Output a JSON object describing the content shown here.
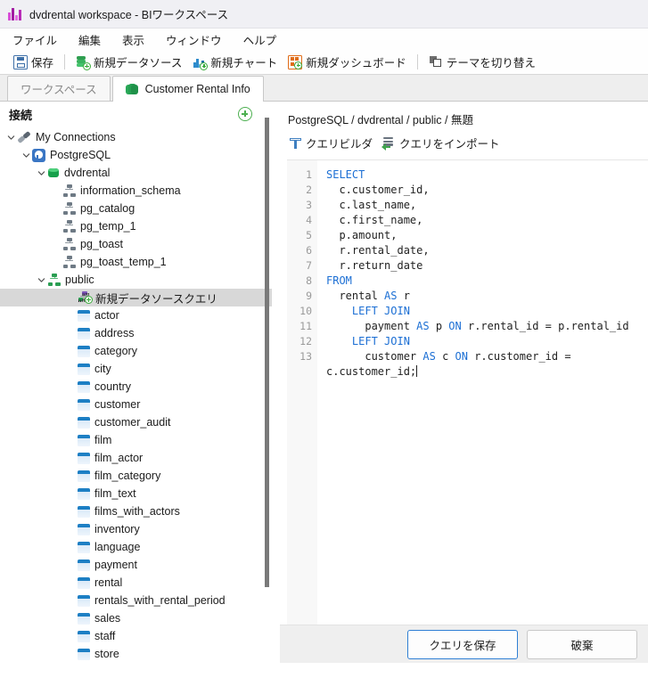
{
  "window": {
    "title": "dvdrental workspace - BIワークスペース",
    "app_icon": "bar-chart-icon"
  },
  "menubar": {
    "items": [
      "ファイル",
      "編集",
      "表示",
      "ウィンドウ",
      "ヘルプ"
    ]
  },
  "toolbar": {
    "save_label": "保存",
    "new_datasource_label": "新規データソース",
    "new_chart_label": "新規チャート",
    "new_dashboard_label": "新規ダッシュボード",
    "switch_theme_label": "テーマを切り替え"
  },
  "tabs": [
    {
      "label": "ワークスペース",
      "active": false,
      "icon": ""
    },
    {
      "label": "Customer Rental Info",
      "active": true,
      "icon": "database-stack-icon"
    }
  ],
  "sidebar": {
    "title": "接続",
    "add_icon": "plus-circle-icon",
    "tree": [
      {
        "label": "My Connections",
        "indent": 0,
        "chevron": "down",
        "icon": "plug-icon",
        "selected": false
      },
      {
        "label": "PostgreSQL",
        "indent": 1,
        "chevron": "down",
        "icon": "postgresql-icon",
        "selected": false
      },
      {
        "label": "dvdrental",
        "indent": 2,
        "chevron": "down",
        "icon": "database-icon",
        "selected": false
      },
      {
        "label": "information_schema",
        "indent": 3,
        "chevron": "none",
        "icon": "schema-icon",
        "selected": false
      },
      {
        "label": "pg_catalog",
        "indent": 3,
        "chevron": "none",
        "icon": "schema-icon",
        "selected": false
      },
      {
        "label": "pg_temp_1",
        "indent": 3,
        "chevron": "none",
        "icon": "schema-icon",
        "selected": false
      },
      {
        "label": "pg_toast",
        "indent": 3,
        "chevron": "none",
        "icon": "schema-icon",
        "selected": false
      },
      {
        "label": "pg_toast_temp_1",
        "indent": 3,
        "chevron": "none",
        "icon": "schema-icon",
        "selected": false
      },
      {
        "label": "public",
        "indent": 2,
        "chevron": "down",
        "icon": "schema-green-icon",
        "selected": false
      },
      {
        "label": "新規データソースクエリ",
        "indent": 4,
        "chevron": "none",
        "icon": "new-query-icon",
        "selected": true
      },
      {
        "label": "actor",
        "indent": 4,
        "chevron": "none",
        "icon": "table-icon",
        "selected": false
      },
      {
        "label": "address",
        "indent": 4,
        "chevron": "none",
        "icon": "table-icon",
        "selected": false
      },
      {
        "label": "category",
        "indent": 4,
        "chevron": "none",
        "icon": "table-icon",
        "selected": false
      },
      {
        "label": "city",
        "indent": 4,
        "chevron": "none",
        "icon": "table-icon",
        "selected": false
      },
      {
        "label": "country",
        "indent": 4,
        "chevron": "none",
        "icon": "table-icon",
        "selected": false
      },
      {
        "label": "customer",
        "indent": 4,
        "chevron": "none",
        "icon": "table-icon",
        "selected": false
      },
      {
        "label": "customer_audit",
        "indent": 4,
        "chevron": "none",
        "icon": "table-icon",
        "selected": false
      },
      {
        "label": "film",
        "indent": 4,
        "chevron": "none",
        "icon": "table-icon",
        "selected": false
      },
      {
        "label": "film_actor",
        "indent": 4,
        "chevron": "none",
        "icon": "table-icon",
        "selected": false
      },
      {
        "label": "film_category",
        "indent": 4,
        "chevron": "none",
        "icon": "table-icon",
        "selected": false
      },
      {
        "label": "film_text",
        "indent": 4,
        "chevron": "none",
        "icon": "table-icon",
        "selected": false
      },
      {
        "label": "films_with_actors",
        "indent": 4,
        "chevron": "none",
        "icon": "table-icon",
        "selected": false
      },
      {
        "label": "inventory",
        "indent": 4,
        "chevron": "none",
        "icon": "table-icon",
        "selected": false
      },
      {
        "label": "language",
        "indent": 4,
        "chevron": "none",
        "icon": "table-icon",
        "selected": false
      },
      {
        "label": "payment",
        "indent": 4,
        "chevron": "none",
        "icon": "table-icon",
        "selected": false
      },
      {
        "label": "rental",
        "indent": 4,
        "chevron": "none",
        "icon": "table-icon",
        "selected": false
      },
      {
        "label": "rentals_with_rental_period",
        "indent": 4,
        "chevron": "none",
        "icon": "table-icon",
        "selected": false
      },
      {
        "label": "sales",
        "indent": 4,
        "chevron": "none",
        "icon": "table-icon",
        "selected": false
      },
      {
        "label": "staff",
        "indent": 4,
        "chevron": "none",
        "icon": "table-icon",
        "selected": false
      },
      {
        "label": "store",
        "indent": 4,
        "chevron": "none",
        "icon": "table-icon",
        "selected": false
      }
    ]
  },
  "editor": {
    "breadcrumb": "PostgreSQL / dvdrental / public / 無題",
    "query_builder_label": "クエリビルダ",
    "import_query_label": "クエリをインポート",
    "line_numbers": [
      "1",
      "2",
      "3",
      "4",
      "5",
      "6",
      "7",
      "8",
      "9",
      "10",
      "11",
      "12",
      "13"
    ],
    "sql_lines": [
      [
        {
          "t": "SELECT",
          "k": true
        }
      ],
      [
        {
          "t": "  c.customer_id,",
          "k": false
        }
      ],
      [
        {
          "t": "  c.last_name,",
          "k": false
        }
      ],
      [
        {
          "t": "  c.first_name,",
          "k": false
        }
      ],
      [
        {
          "t": "  p.amount,",
          "k": false
        }
      ],
      [
        {
          "t": "  r.rental_date,",
          "k": false
        }
      ],
      [
        {
          "t": "  r.return_date",
          "k": false
        }
      ],
      [
        {
          "t": "FROM",
          "k": true
        }
      ],
      [
        {
          "t": "  rental ",
          "k": false
        },
        {
          "t": "AS",
          "k": true
        },
        {
          "t": " r",
          "k": false
        }
      ],
      [
        {
          "t": "    ",
          "k": false
        },
        {
          "t": "LEFT JOIN",
          "k": true
        }
      ],
      [
        {
          "t": "      payment ",
          "k": false
        },
        {
          "t": "AS",
          "k": true
        },
        {
          "t": " p ",
          "k": false
        },
        {
          "t": "ON",
          "k": true
        },
        {
          "t": " r.rental_id = p.rental_id",
          "k": false
        }
      ],
      [
        {
          "t": "    ",
          "k": false
        },
        {
          "t": "LEFT JOIN",
          "k": true
        }
      ],
      [
        {
          "t": "      customer ",
          "k": false
        },
        {
          "t": "AS",
          "k": true
        },
        {
          "t": " c ",
          "k": false
        },
        {
          "t": "ON",
          "k": true
        },
        {
          "t": " r.customer_id = c.customer_id;",
          "k": false
        }
      ]
    ],
    "sql_text": "SELECT\n  c.customer_id,\n  c.last_name,\n  c.first_name,\n  p.amount,\n  r.rental_date,\n  r.return_date\nFROM\n  rental AS r\n    LEFT JOIN\n      payment AS p ON r.rental_id = p.rental_id\n    LEFT JOIN\n      customer AS c ON r.customer_id = c.customer_id;"
  },
  "footer": {
    "save_query_label": "クエリを保存",
    "discard_label": "破棄"
  },
  "colors": {
    "accent": "#2f7fd4",
    "keyword": "#1c6fd4",
    "selection": "#d8d8d8",
    "green": "#2a9e52",
    "titlebar": "#f0f0f4"
  }
}
